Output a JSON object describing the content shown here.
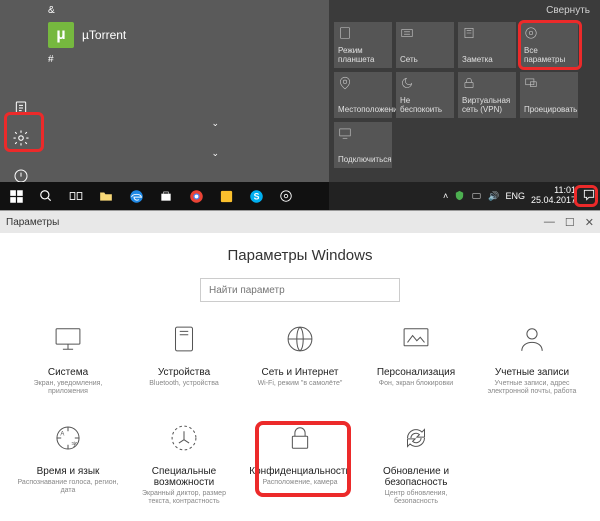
{
  "startmenu": {
    "amp": "&",
    "app_label": "µTorrent",
    "hash": "#"
  },
  "actioncenter": {
    "collapse": "Свернуть",
    "tiles": [
      {
        "label": "Режим планшета"
      },
      {
        "label": "Сеть"
      },
      {
        "label": "Заметка"
      },
      {
        "label": "Все параметры"
      },
      {
        "label": "Местоположение"
      },
      {
        "label": "Не беспокоить"
      },
      {
        "label": "Виртуальная сеть (VPN)"
      },
      {
        "label": "Проецировать"
      },
      {
        "label": "Подключиться"
      }
    ],
    "lang": "ENG",
    "time": "11:01",
    "date": "25.04.2017"
  },
  "settings": {
    "titlebar": "Параметры",
    "heading": "Параметры Windows",
    "search_placeholder": "Найти параметр",
    "items": [
      {
        "label": "Система",
        "desc": "Экран, уведомления, приложения"
      },
      {
        "label": "Устройства",
        "desc": "Bluetooth, устройства"
      },
      {
        "label": "Сеть и Интернет",
        "desc": "Wi-Fi, режим \"в самолёте\""
      },
      {
        "label": "Персонализация",
        "desc": "Фон, экран блокировки"
      },
      {
        "label": "Учетные записи",
        "desc": "Учетные записи, адрес электронной почты, работа"
      },
      {
        "label": "Время и язык",
        "desc": "Распознавание голоса, регион, дата"
      },
      {
        "label": "Специальные возможности",
        "desc": "Экранный диктор, размер текста, контрастность"
      },
      {
        "label": "Конфиденциальность",
        "desc": "Расположение, камера"
      },
      {
        "label": "Обновление и безопасность",
        "desc": "Центр обновления, безопасность"
      }
    ]
  }
}
